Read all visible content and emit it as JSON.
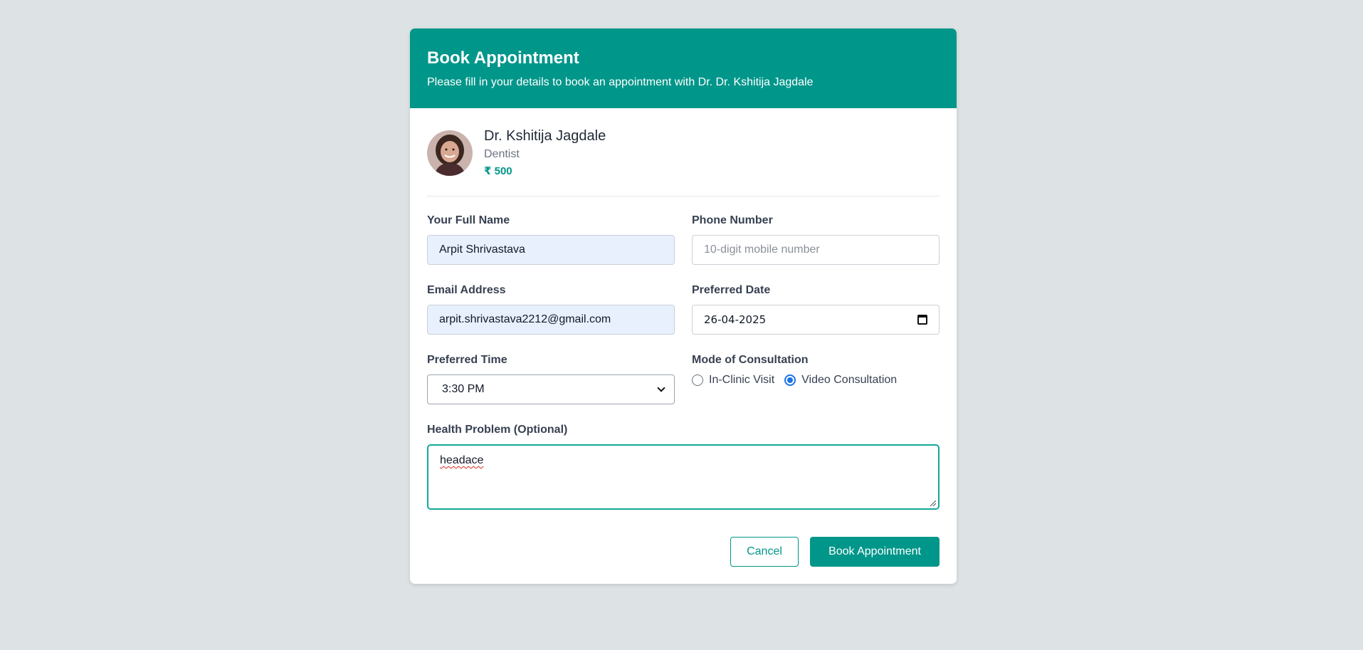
{
  "modal": {
    "title": "Book Appointment",
    "subtitle": "Please fill in your details to book an appointment with Dr. Dr. Kshitija Jagdale"
  },
  "doctor": {
    "name": "Dr. Kshitija Jagdale",
    "specialty": "Dentist",
    "fee": "₹ 500"
  },
  "form": {
    "full_name": {
      "label": "Your Full Name",
      "value": "Arpit Shrivastava"
    },
    "phone": {
      "label": "Phone Number",
      "value": "",
      "placeholder": "10-digit mobile number"
    },
    "email": {
      "label": "Email Address",
      "value": "arpit.shrivastava2212@gmail.com"
    },
    "date": {
      "label": "Preferred Date",
      "value": "26-04-2025"
    },
    "time": {
      "label": "Preferred Time",
      "selected": "3:30 PM"
    },
    "mode": {
      "label": "Mode of Consultation",
      "options": [
        "In-Clinic Visit",
        "Video Consultation"
      ],
      "selected": "Video Consultation"
    },
    "health_problem": {
      "label": "Health Problem (Optional)",
      "value": "headace"
    }
  },
  "actions": {
    "cancel": "Cancel",
    "submit": "Book Appointment"
  },
  "colors": {
    "accent": "#00968a",
    "page_bg": "#dde2e5",
    "autofill_bg": "#e8f0fe",
    "radio_checked": "#1a73e8"
  }
}
